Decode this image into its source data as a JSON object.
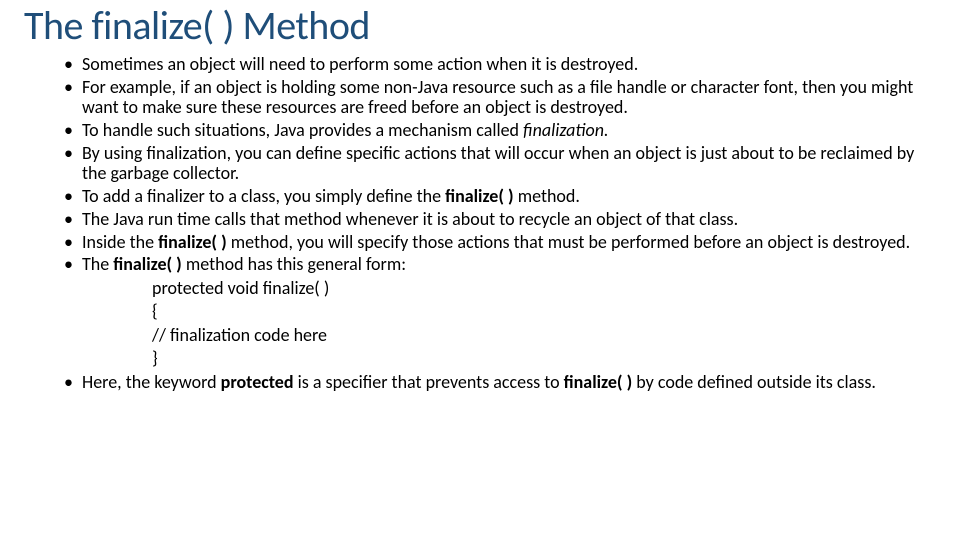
{
  "title": "The finalize( ) Method",
  "bullets": {
    "b0": "Sometimes an object will need to perform some action when it is destroyed.",
    "b1": "For example, if an object is holding some non-Java resource such as a file handle or character font, then you might want to make sure these resources are freed before an object is destroyed.",
    "b2_pre": "To handle such situations, Java provides a mechanism called ",
    "b2_em": "finalization.",
    "b3": "By using finalization, you can define specific actions that will occur when an object is just about to be reclaimed by the garbage collector.",
    "b4_pre": "To add a finalizer to a class, you simply define the ",
    "b4_bold": "finalize( )",
    "b4_post": " method.",
    "b5": "The Java run time calls that method whenever it is about to recycle an object of that class.",
    "b6_pre": "Inside the ",
    "b6_bold": "finalize( )",
    "b6_post": " method, you will specify those actions that must be performed before an object is destroyed.",
    "b7_pre": "The ",
    "b7_bold": "finalize( )",
    "b7_post": " method has this general form:",
    "code": {
      "l1": "protected void finalize( )",
      "l2": "{",
      "l3": "// finalization code here",
      "l4": "}"
    },
    "b8_pre": "Here, the keyword ",
    "b8_bold1": "protected",
    "b8_mid": " is a specifier that prevents access to ",
    "b8_bold2": "finalize( )",
    "b8_post": " by code defined outside its class."
  }
}
